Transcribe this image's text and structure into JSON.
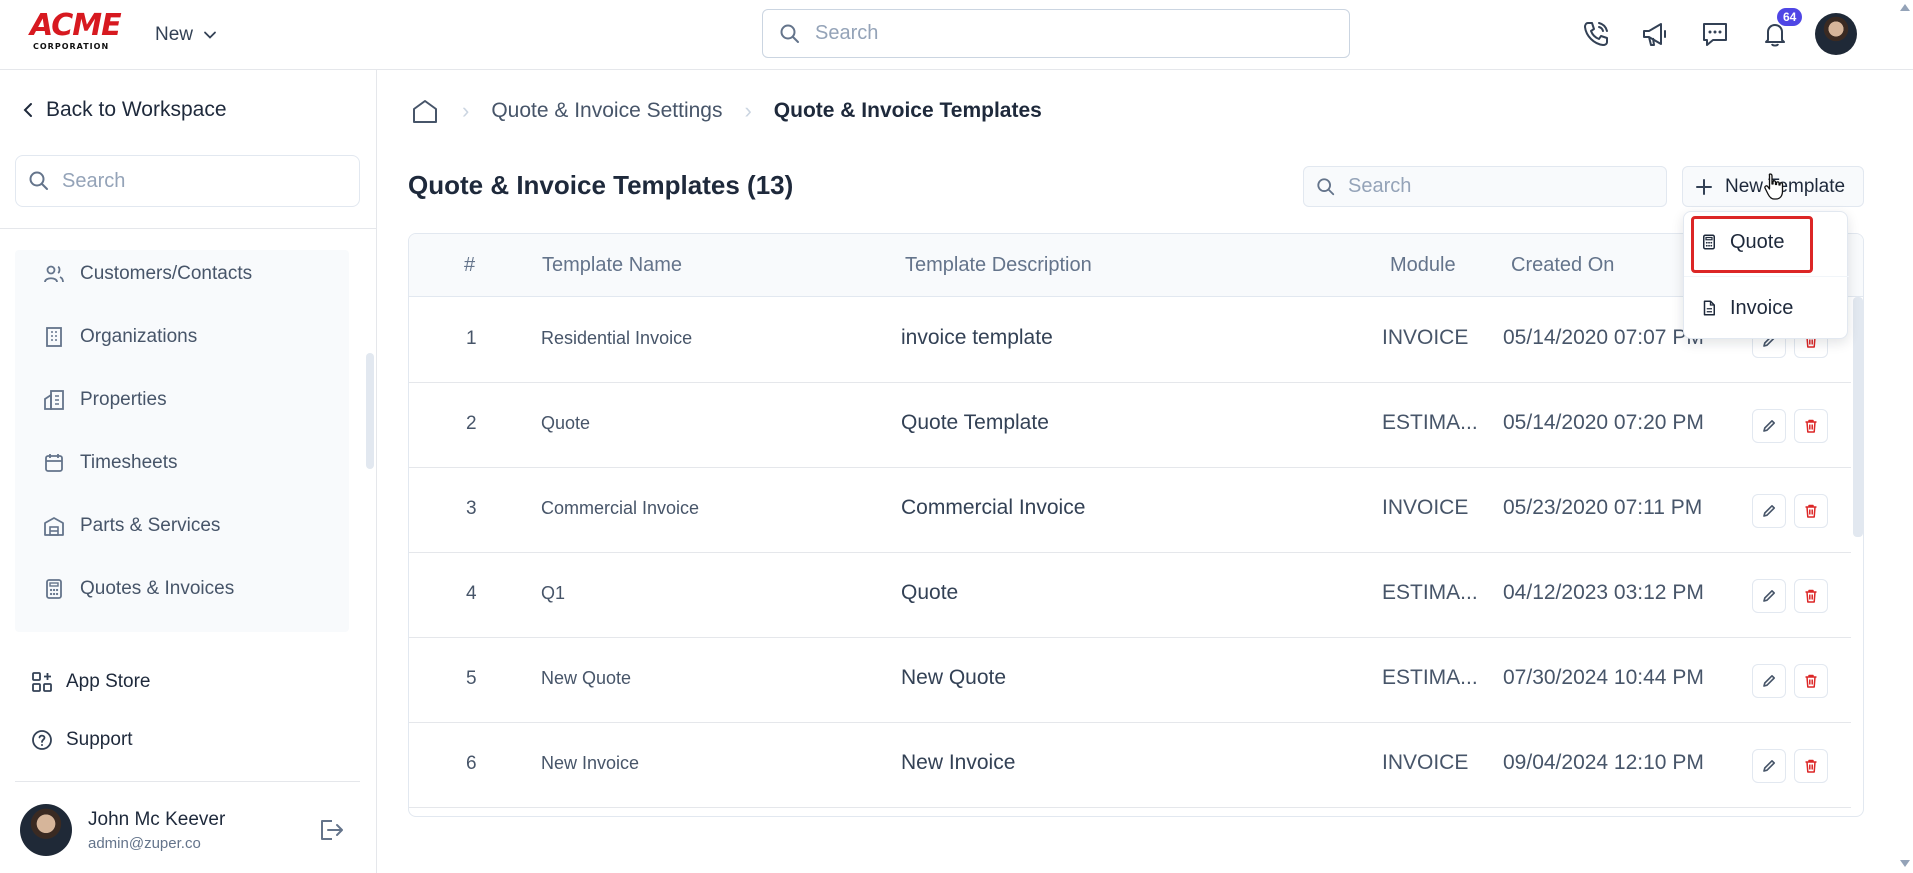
{
  "header": {
    "logo_word": "ACME",
    "logo_sub": "CORPORATION",
    "new_label": "New",
    "search_placeholder": "Search",
    "notification_count": "64"
  },
  "sidebar": {
    "back_label": "Back to Workspace",
    "search_placeholder": "Search",
    "items": [
      {
        "label": "Customers/Contacts",
        "icon": "users-icon"
      },
      {
        "label": "Organizations",
        "icon": "building-icon"
      },
      {
        "label": "Properties",
        "icon": "properties-icon"
      },
      {
        "label": "Timesheets",
        "icon": "calendar-icon"
      },
      {
        "label": "Parts & Services",
        "icon": "warehouse-icon"
      },
      {
        "label": "Quotes & Invoices",
        "icon": "calculator-icon"
      }
    ],
    "links": [
      {
        "label": "App Store",
        "icon": "apps-icon"
      },
      {
        "label": "Support",
        "icon": "help-icon"
      }
    ],
    "user": {
      "name": "John Mc Keever",
      "email": "admin@zuper.co"
    }
  },
  "breadcrumb": {
    "items": [
      "Quote & Invoice Settings",
      "Quote & Invoice Templates"
    ]
  },
  "page": {
    "title": "Quote & Invoice Templates (13)",
    "search_placeholder": "Search",
    "new_template_label": "New Template"
  },
  "dropdown": {
    "items": [
      "Quote",
      "Invoice"
    ]
  },
  "table": {
    "columns": [
      "#",
      "Template Name",
      "Template Description",
      "Module",
      "Created On"
    ],
    "rows": [
      {
        "idx": "1",
        "name": "Residential Invoice",
        "desc": "invoice template",
        "module": "INVOICE",
        "created": "05/14/2020 07:07 PM"
      },
      {
        "idx": "2",
        "name": "Quote",
        "desc": "Quote Template",
        "module": "ESTIMA...",
        "created": "05/14/2020 07:20 PM"
      },
      {
        "idx": "3",
        "name": "Commercial Invoice",
        "desc": "Commercial Invoice",
        "module": "INVOICE",
        "created": "05/23/2020 07:11 PM"
      },
      {
        "idx": "4",
        "name": "Q1",
        "desc": "Quote",
        "module": "ESTIMA...",
        "created": "04/12/2023 03:12 PM"
      },
      {
        "idx": "5",
        "name": "New Quote",
        "desc": "New Quote",
        "module": "ESTIMA...",
        "created": "07/30/2024 10:44 PM"
      },
      {
        "idx": "6",
        "name": "New Invoice",
        "desc": "New Invoice",
        "module": "INVOICE",
        "created": "09/04/2024 12:10 PM"
      }
    ]
  },
  "colors": {
    "brand": "#d71920",
    "accent": "#4f46e5",
    "delete": "#dc2626",
    "highlight": "#dc2626"
  }
}
